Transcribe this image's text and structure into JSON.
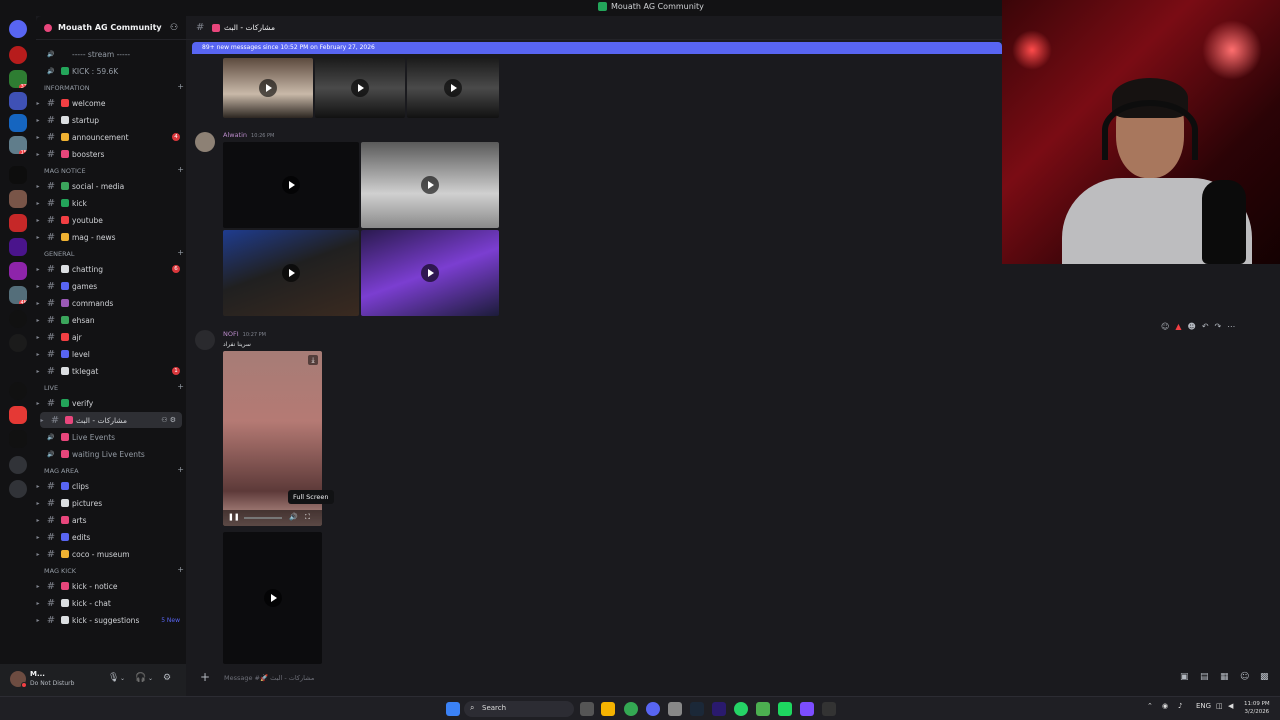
{
  "window": {
    "title": "Mouath AG Community"
  },
  "server": {
    "name": "Mouath AG Community"
  },
  "sidebar": {
    "top_voice": [
      {
        "label": "----- stream -----"
      },
      {
        "label": "KICK : 59.6K"
      }
    ],
    "categories": [
      {
        "name": "INFORMATION",
        "channels": [
          {
            "label": "welcome",
            "color": "#f23f43"
          },
          {
            "label": "startup",
            "color": "#dbdee1"
          },
          {
            "label": "announcement",
            "color": "#f0b232",
            "badge": "4"
          },
          {
            "label": "boosters",
            "color": "#e8467c"
          }
        ]
      },
      {
        "name": "MAG NOTICE",
        "channels": [
          {
            "label": "social - media",
            "color": "#3ba55c"
          },
          {
            "label": "kick",
            "color": "#23a55a"
          },
          {
            "label": "youtube",
            "color": "#f23f43"
          },
          {
            "label": "mag - news",
            "color": "#f0b232"
          }
        ]
      },
      {
        "name": "GENERAL",
        "channels": [
          {
            "label": "chatting",
            "color": "#dbdee1",
            "badge": "6"
          },
          {
            "label": "games",
            "color": "#5865f2"
          },
          {
            "label": "commands",
            "color": "#9b59b6"
          },
          {
            "label": "ehsan",
            "color": "#3ba55c"
          },
          {
            "label": "ajr",
            "color": "#f23f43"
          },
          {
            "label": "level",
            "color": "#5865f2"
          },
          {
            "label": "tklegat",
            "color": "#dbdee1",
            "badge": "1"
          }
        ]
      },
      {
        "name": "LIVE",
        "channels": [
          {
            "label": "verify",
            "color": "#23a55a"
          },
          {
            "label": "مشاركات - البث",
            "color": "#e8467c",
            "active": true
          },
          {
            "label": "Live Events",
            "color": "#e8467c",
            "voice": true
          },
          {
            "label": "waiting Live Events",
            "color": "#e8467c",
            "voice": true
          }
        ]
      },
      {
        "name": "MAG AREA",
        "channels": [
          {
            "label": "clips",
            "color": "#5865f2"
          },
          {
            "label": "pictures",
            "color": "#dbdee1"
          },
          {
            "label": "arts",
            "color": "#e8467c"
          },
          {
            "label": "edits",
            "color": "#5865f2"
          },
          {
            "label": "coco - museum",
            "color": "#f0b232"
          }
        ]
      },
      {
        "name": "MAG KICK",
        "channels": [
          {
            "label": "kick - notice",
            "color": "#e8467c"
          },
          {
            "label": "kick - chat",
            "color": "#dbdee1"
          },
          {
            "label": "kick - suggestions",
            "color": "#dbdee1",
            "newtag": "5 New"
          }
        ]
      }
    ]
  },
  "user": {
    "name": "M...",
    "status": "Do Not Disturb"
  },
  "chat": {
    "channel_title": "مشاركات - البث",
    "new_messages_bar": "89+ new messages since 10:52 PM on February 27, 2026",
    "messages": [
      {
        "author": "Alwatin",
        "time": "10:26 PM"
      },
      {
        "author": "NOFI",
        "time": "10:27 PM",
        "text": "سرينا نفراد"
      }
    ],
    "tooltip": "Full Screen",
    "composer_placeholder": "Message #🚀 مشاركات - البث"
  },
  "taskbar": {
    "search_label": "Search",
    "lang": "ENG",
    "time": "11:09 PM",
    "date": "3/2/2026"
  },
  "colors": {
    "accent": "#5865f2",
    "bg": "#1a1a1e",
    "danger": "#f23f43"
  }
}
